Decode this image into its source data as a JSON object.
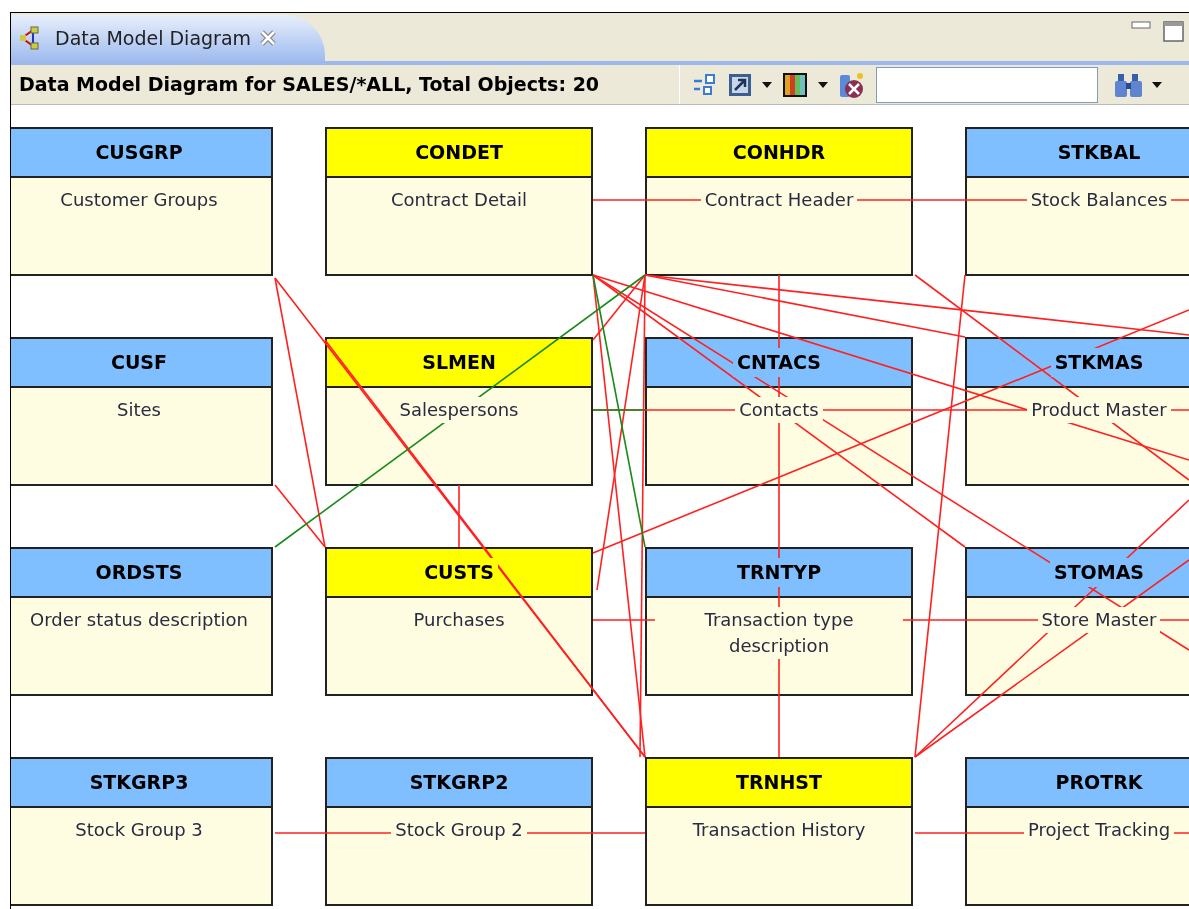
{
  "tab": {
    "title": "Data Model Diagram",
    "selected": true
  },
  "toolbar": {
    "title": "Data Model Diagram for SALES/*ALL, Total Objects: 20"
  },
  "entity_rows": [
    [
      {
        "name": "CUSGRP",
        "description": "Customer Groups",
        "highlighted": false
      },
      {
        "name": "CONDET",
        "description": "Contract Detail",
        "highlighted": true
      },
      {
        "name": "CONHDR",
        "description": "Contract Header",
        "highlighted": true
      },
      {
        "name": "STKBAL",
        "description": "Stock Balances",
        "highlighted": false
      }
    ],
    [
      {
        "name": "CUSF",
        "description": "Sites",
        "highlighted": false
      },
      {
        "name": "SLMEN",
        "description": "Salespersons",
        "highlighted": true
      },
      {
        "name": "CNTACS",
        "description": "Contacts",
        "highlighted": false
      },
      {
        "name": "STKMAS",
        "description": "Product Master",
        "highlighted": false
      }
    ],
    [
      {
        "name": "ORDSTS",
        "description": "Order status description",
        "highlighted": false
      },
      {
        "name": "CUSTS",
        "description": "Purchases",
        "highlighted": true
      },
      {
        "name": "TRNTYP",
        "description": "Transaction type description",
        "highlighted": false
      },
      {
        "name": "STOMAS",
        "description": "Store Master",
        "highlighted": false
      }
    ],
    [
      {
        "name": "STKGRP3",
        "description": "Stock Group 3",
        "highlighted": false
      },
      {
        "name": "STKGRP2",
        "description": "Stock Group 2",
        "highlighted": false
      },
      {
        "name": "TRNHST",
        "description": "Transaction History",
        "highlighted": true
      },
      {
        "name": "PROTRK",
        "description": "Project Tracking",
        "highlighted": false
      }
    ]
  ]
}
